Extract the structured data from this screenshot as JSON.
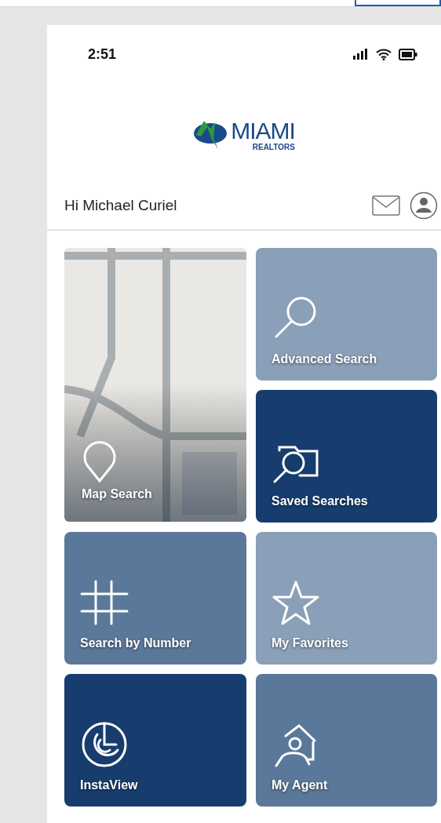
{
  "status_bar": {
    "time": "2:51"
  },
  "logo": {
    "name": "MIAMI",
    "subtitle": "REALTORS"
  },
  "greeting": "Hi Michael Curiel",
  "tiles": [
    {
      "kind": "icon",
      "label": "Advanced Search",
      "color": "#8a9fb8"
    },
    {
      "kind": "map",
      "label": "Map Search"
    },
    {
      "kind": "icon",
      "label": "Saved Searches",
      "color": "#163d6e"
    },
    {
      "kind": "icon",
      "label": "Search by Number",
      "color": "#5a7899"
    },
    {
      "kind": "icon",
      "label": "My Favorites",
      "color": "#8a9fb8"
    },
    {
      "kind": "icon",
      "label": "InstaView",
      "color": "#163d6e"
    },
    {
      "kind": "icon",
      "label": "My Agent",
      "color": "#5a7899"
    }
  ]
}
